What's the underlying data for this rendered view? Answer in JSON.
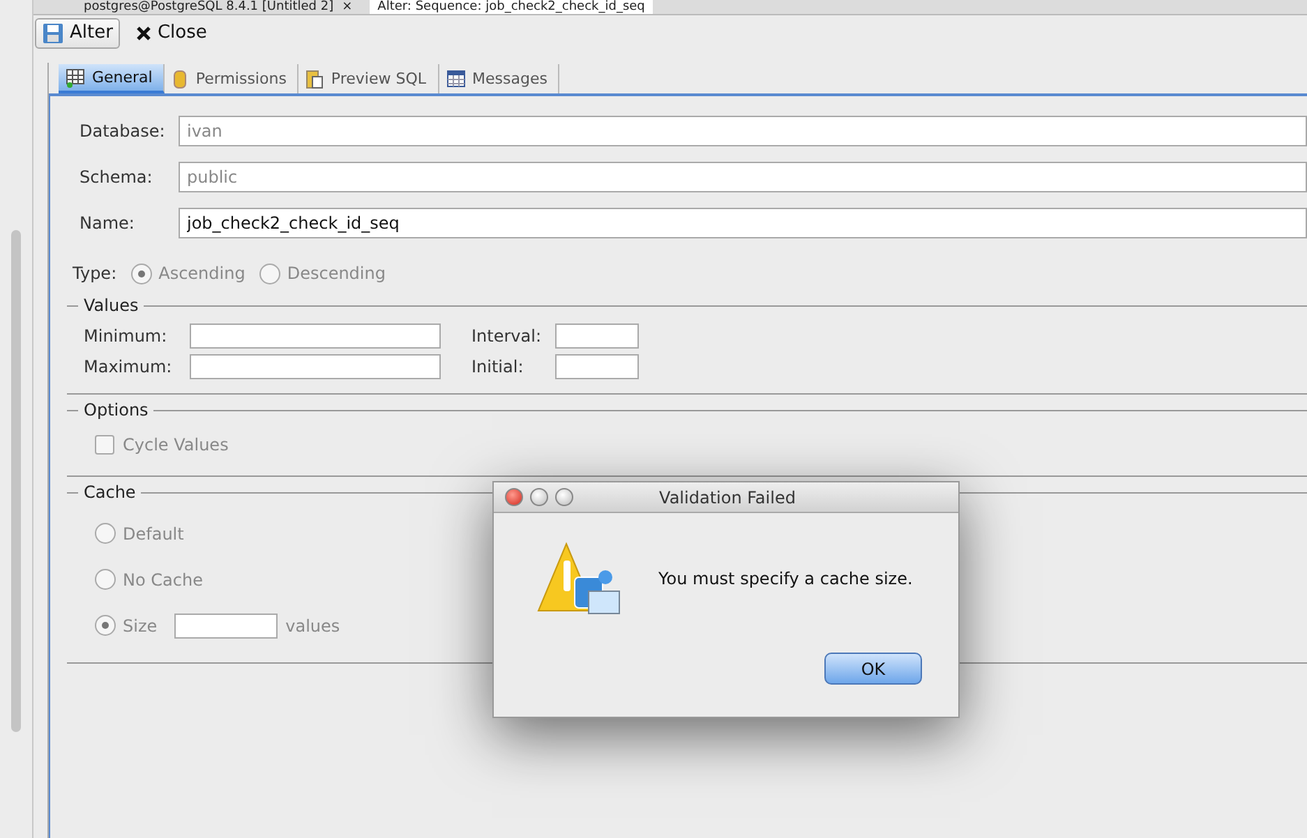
{
  "doc_tabs": [
    {
      "label": "postgres@PostgreSQL 8.4.1 [Untitled 2]",
      "selected": false,
      "close": "×"
    },
    {
      "label": "Alter: Sequence: job_check2_check_id_seq",
      "selected": true
    }
  ],
  "toolbar": [
    {
      "label": "Alter",
      "kind": "save"
    },
    {
      "label": "Close",
      "kind": "close"
    }
  ],
  "tabs": [
    {
      "label": "General",
      "selected": true,
      "kind": "grid"
    },
    {
      "label": "Permissions",
      "selected": false,
      "kind": "perm"
    },
    {
      "label": "Preview SQL",
      "selected": false,
      "kind": "sql"
    },
    {
      "label": "Messages",
      "selected": false,
      "kind": "msg"
    }
  ],
  "fields": [
    {
      "label": "Database:",
      "value": "ivan",
      "disabled": true
    },
    {
      "label": "Schema:",
      "value": "public",
      "disabled": true
    },
    {
      "label": "Name:",
      "value": "job_check2_check_id_seq",
      "disabled": false
    }
  ],
  "type": {
    "label": "Type:",
    "options": [
      {
        "label": "Ascending",
        "selected": true
      },
      {
        "label": "Descending",
        "selected": false
      }
    ]
  },
  "values": {
    "title": "Values",
    "fields": [
      {
        "label": "Minimum:"
      },
      {
        "label": "Interval:"
      },
      {
        "label": "Maximum:"
      },
      {
        "label": "Initial:"
      }
    ]
  },
  "options": {
    "title": "Options",
    "items": [
      {
        "label": "Cycle Values",
        "checked": false
      }
    ]
  },
  "cache": {
    "title": "Cache",
    "options": [
      {
        "label": "Default",
        "selected": false
      },
      {
        "label": "No Cache",
        "selected": false
      },
      {
        "label": "Size",
        "selected": true,
        "suffix": "values"
      }
    ]
  },
  "dialog": {
    "title": "Validation Failed",
    "message": "You must specify a cache size.",
    "button": "OK"
  }
}
